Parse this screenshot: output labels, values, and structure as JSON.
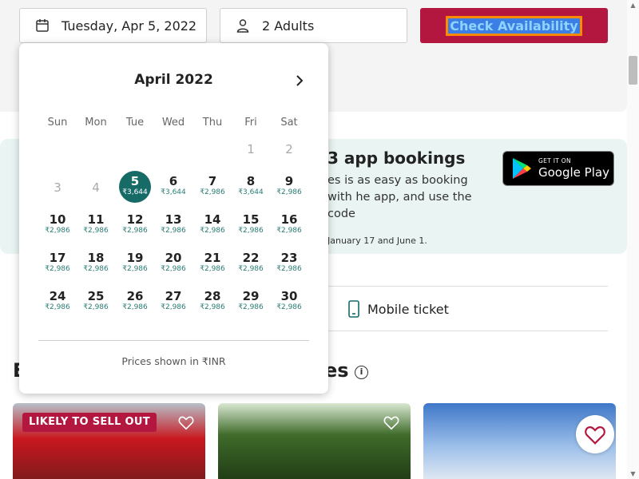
{
  "search": {
    "date_value": "Tuesday, Apr 5, 2022",
    "guests_value": "2 Adults",
    "check_label": "Check Availability"
  },
  "calendar": {
    "month": "April 2022",
    "weekdays": [
      "Sun",
      "Mon",
      "Tue",
      "Wed",
      "Thu",
      "Fri",
      "Sat"
    ],
    "weeks": [
      [
        null,
        null,
        null,
        null,
        null,
        {
          "d": "1",
          "p": "",
          "disabled": true
        },
        {
          "d": "2",
          "p": "",
          "disabled": true
        }
      ],
      [
        {
          "d": "3",
          "p": "",
          "disabled": true
        },
        {
          "d": "4",
          "p": "",
          "disabled": true
        },
        {
          "d": "5",
          "p": "₹3,644",
          "selected": true
        },
        {
          "d": "6",
          "p": "₹3,644"
        },
        {
          "d": "7",
          "p": "₹2,986"
        },
        {
          "d": "8",
          "p": "₹3,644"
        },
        {
          "d": "9",
          "p": "₹2,986"
        }
      ],
      [
        {
          "d": "10",
          "p": "₹2,986"
        },
        {
          "d": "11",
          "p": "₹2,986"
        },
        {
          "d": "12",
          "p": "₹2,986"
        },
        {
          "d": "13",
          "p": "₹2,986"
        },
        {
          "d": "14",
          "p": "₹2,986"
        },
        {
          "d": "15",
          "p": "₹2,986"
        },
        {
          "d": "16",
          "p": "₹2,986"
        }
      ],
      [
        {
          "d": "17",
          "p": "₹2,986"
        },
        {
          "d": "18",
          "p": "₹2,986"
        },
        {
          "d": "19",
          "p": "₹2,986"
        },
        {
          "d": "20",
          "p": "₹2,986"
        },
        {
          "d": "21",
          "p": "₹2,986"
        },
        {
          "d": "22",
          "p": "₹2,986"
        },
        {
          "d": "23",
          "p": "₹2,986"
        }
      ],
      [
        {
          "d": "24",
          "p": "₹2,986"
        },
        {
          "d": "25",
          "p": "₹2,986"
        },
        {
          "d": "26",
          "p": "₹2,986"
        },
        {
          "d": "27",
          "p": "₹2,986"
        },
        {
          "d": "28",
          "p": "₹2,986"
        },
        {
          "d": "29",
          "p": "₹2,986"
        },
        {
          "d": "30",
          "p": "₹2,986"
        }
      ]
    ],
    "footer": "Prices shown in ₹INR"
  },
  "promo": {
    "title": "3 app bookings",
    "text": "es is as easy as booking with he app, and use the code",
    "footnote": "January 17 and June 1.",
    "store_small": "GET IT ON",
    "store_big": "Google Play"
  },
  "features": {
    "mobile_ticket": "Mobile ticket"
  },
  "section": {
    "head_start": "E",
    "head_end": "es",
    "info_icon": "i"
  },
  "cards": {
    "badge": "LIKELY TO SELL OUT"
  },
  "colors": {
    "brand": "#b3173f",
    "selected_day": "#176b67",
    "price_text": "#2a7d74"
  }
}
